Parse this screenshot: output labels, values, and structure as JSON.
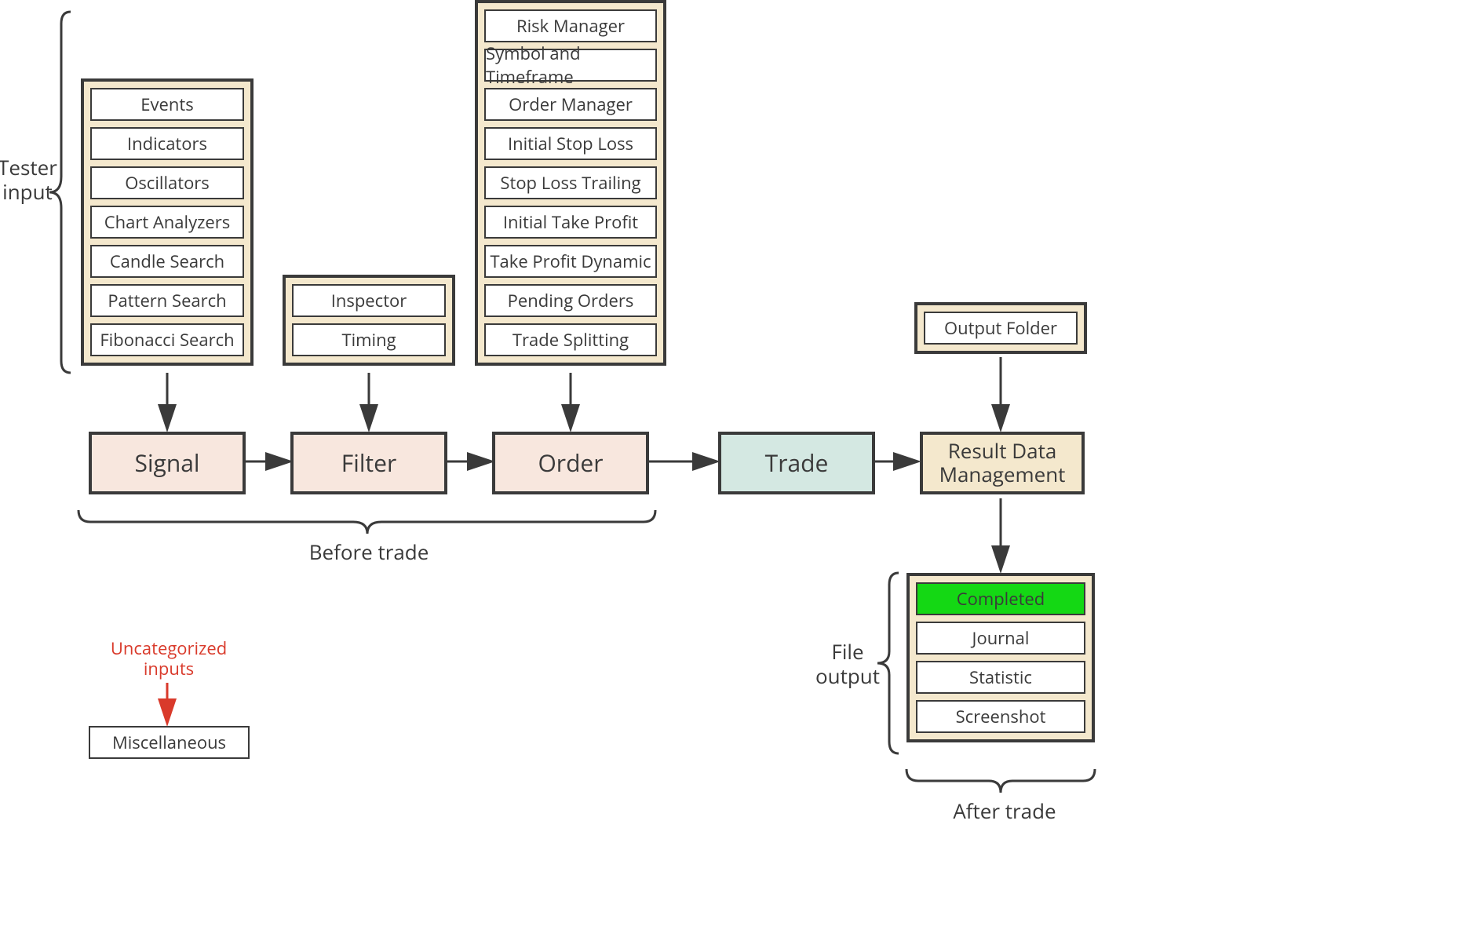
{
  "labels": {
    "tester_input": "Tester\ninput",
    "before_trade": "Before trade",
    "after_trade": "After trade",
    "file_output": "File\noutput",
    "uncategorized": "Uncategorized\ninputs",
    "miscellaneous": "Miscellaneous"
  },
  "main_nodes": {
    "signal": "Signal",
    "filter": "Filter",
    "order": "Order",
    "trade": "Trade",
    "result": "Result Data\nManagement"
  },
  "groups": {
    "signal_items": [
      "Events",
      "Indicators",
      "Oscillators",
      "Chart Analyzers",
      "Candle Search",
      "Pattern Search",
      "Fibonacci Search"
    ],
    "filter_items": [
      "Inspector",
      "Timing"
    ],
    "order_items": [
      "Risk Manager",
      "Symbol and Timeframe",
      "Order Manager",
      "Initial Stop Loss",
      "Stop Loss Trailing",
      "Initial Take Profit",
      "Take Profit Dynamic",
      "Pending Orders",
      "Trade Splitting"
    ],
    "result_input_items": [
      "Output Folder"
    ],
    "result_output_items": [
      "Completed",
      "Journal",
      "Statistic",
      "Screenshot"
    ]
  },
  "colors": {
    "peach": "#f8e7de",
    "teal": "#d4e8e2",
    "cream": "#f4e8cd",
    "green": "#14d814",
    "red": "#d93a2b",
    "stroke": "#3a3a3a"
  }
}
